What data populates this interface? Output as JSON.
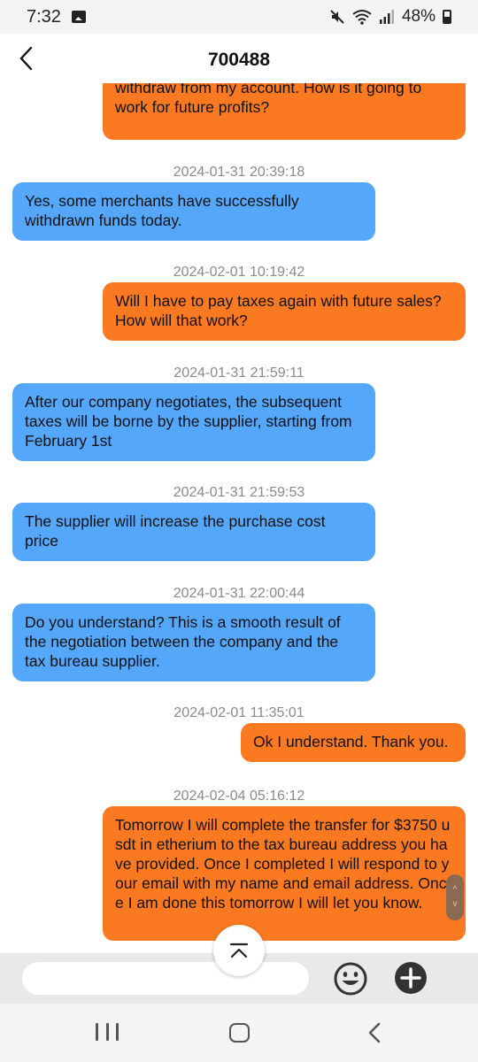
{
  "status_bar": {
    "time": "7:32",
    "battery": "48%"
  },
  "header": {
    "title": "700488"
  },
  "messages": [
    {
      "timestamp": "",
      "type": "sent",
      "text": "Once everything is complete and I am able to withdraw from my account. How is it going to work for future profits?"
    },
    {
      "timestamp": "2024-01-31 20:39:18",
      "type": "received",
      "text": "Yes, some merchants have successfully withdrawn funds today."
    },
    {
      "timestamp": "2024-02-01 10:19:42",
      "type": "sent",
      "text": "Will I have to pay taxes again with future sales? How will that work?"
    },
    {
      "timestamp": "2024-01-31 21:59:11",
      "type": "received",
      "text": "After our company negotiates, the subsequent taxes will be borne by the supplier, starting from February 1st"
    },
    {
      "timestamp": "2024-01-31 21:59:53",
      "type": "received",
      "text": "The supplier will increase the purchase cost price"
    },
    {
      "timestamp": "2024-01-31 22:00:44",
      "type": "received",
      "text": "Do you understand? This is a smooth result of the negotiation between the company and the tax bureau supplier."
    },
    {
      "timestamp": "2024-02-01 11:35:01",
      "type": "sent",
      "text": "Ok I understand. Thank you."
    },
    {
      "timestamp": "2024-02-04 05:16:12",
      "type": "sent",
      "text": "Tomorrow I will complete the transfer for $3750 usdt in etherium to the tax bureau address you have provided. Once I completed I will respond to your email with my name and email address. Once I am done this tomorrow I will let you know."
    }
  ],
  "colors": {
    "sent_bubble": "#fb7920",
    "received_bubble": "#54a7fb",
    "timestamp_text": "#8a8a8a"
  },
  "icons": {
    "back": "chevron-left-icon",
    "scroll_top": "chevron-up-bar-icon",
    "emoji": "smiley-icon",
    "attach": "plus-circle-icon"
  }
}
